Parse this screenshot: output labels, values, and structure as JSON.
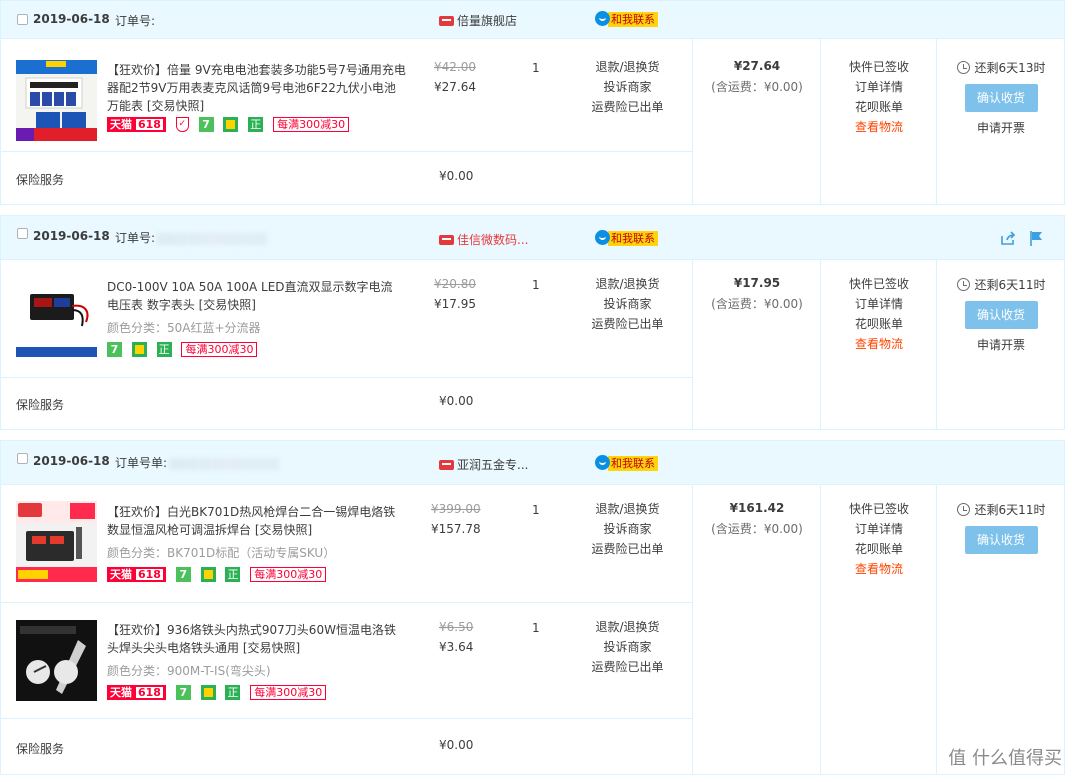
{
  "watermark": "值 什么值得买",
  "orders": [
    {
      "date": "2019-06-18",
      "order_no_label": "订单号:",
      "shop": "倍量旗舰店",
      "contact": "和我联系",
      "items": [
        {
          "title": "【狂欢价】倍量 9V充电电池套装多功能5号7号通用充电器配2节9V万用表麦克风话筒9号电池6F22九伏小电池万能表 [交易快照]",
          "sku": "",
          "tags": {
            "tmall": "天猫",
            "tmall_618": "618",
            "shield": true,
            "seven": "7",
            "gift": true,
            "zheng": "正",
            "promo": "每满300减30"
          },
          "orig_price": "¥42.00",
          "price": "¥27.64",
          "qty": "1",
          "ops": [
            "退款/退换货",
            "投诉商家",
            "运费险已出单"
          ]
        }
      ],
      "total": "¥27.64",
      "shipping": "(含运费：¥0.00)",
      "status": [
        "快件已签收",
        "订单详情",
        "花呗账单"
      ],
      "status_link": "查看物流",
      "timer": "还剩6天13时",
      "confirm": "确认收货",
      "invoice": "申请开票",
      "insurance_label": "保险服务",
      "insurance_price": "¥0.00"
    },
    {
      "date": "2019-06-18",
      "order_no_label": "订单号:",
      "shop": "佳信微数码...",
      "contact": "和我联系",
      "items": [
        {
          "title": "DC0-100V 10A 50A 100A LED直流双显示数字电流电压表 数字表头 [交易快照]",
          "sku": "颜色分类：50A红蓝+分流器",
          "tags": {
            "seven": "7",
            "gift": true,
            "zheng": "正",
            "promo": "每满300减30"
          },
          "orig_price": "¥20.80",
          "price": "¥17.95",
          "qty": "1",
          "ops": [
            "退款/退换货",
            "投诉商家",
            "运费险已出单"
          ]
        }
      ],
      "total": "¥17.95",
      "shipping": "(含运费：¥0.00)",
      "status": [
        "快件已签收",
        "订单详情",
        "花呗账单"
      ],
      "status_link": "查看物流",
      "timer": "还剩6天11时",
      "confirm": "确认收货",
      "invoice": "申请开票",
      "insurance_label": "保险服务",
      "insurance_price": "¥0.00"
    },
    {
      "date": "2019-06-18",
      "order_no_label": "订单号单:",
      "shop": "亚润五金专...",
      "contact": "和我联系",
      "items": [
        {
          "title": "【狂欢价】白光BK701D热风枪焊台二合一锡焊电烙铁数显恒温风枪可调温拆焊台 [交易快照]",
          "sku": "颜色分类：BK701D标配（活动专属SKU）",
          "tags": {
            "tmall": "天猫",
            "tmall_618": "618",
            "seven": "7",
            "gift": true,
            "zheng": "正",
            "promo": "每满300减30"
          },
          "orig_price": "¥399.00",
          "price": "¥157.78",
          "qty": "1",
          "ops": [
            "退款/退换货",
            "投诉商家",
            "运费险已出单"
          ]
        },
        {
          "title": "【狂欢价】936烙铁头内热式907刀头60W恒温电洛铁头焊头尖头电烙铁头通用 [交易快照]",
          "sku": "颜色分类：900M-T-IS(弯尖头)",
          "tags": {
            "tmall": "天猫",
            "tmall_618": "618",
            "seven": "7",
            "gift": true,
            "zheng": "正",
            "promo": "每满300减30"
          },
          "orig_price": "¥6.50",
          "price": "¥3.64",
          "qty": "1",
          "ops": [
            "退款/退换货",
            "投诉商家",
            "运费险已出单"
          ]
        }
      ],
      "total": "¥161.42",
      "shipping": "(含运费：¥0.00)",
      "status": [
        "快件已签收",
        "订单详情",
        "花呗账单"
      ],
      "status_link": "查看物流",
      "timer": "还剩6天11时",
      "confirm": "确认收货",
      "invoice": "",
      "insurance_label": "保险服务",
      "insurance_price": "¥0.00"
    }
  ],
  "thumbs": {
    "o1": {
      "badge": "1充+2节9V电池",
      "sub": "送电池盒"
    },
    "o3a": {
      "badge": "秒杀",
      "sub": "到手价",
      "price": "399 251"
    },
    "o3b": {
      "label": "型号900M-T-IS"
    }
  }
}
